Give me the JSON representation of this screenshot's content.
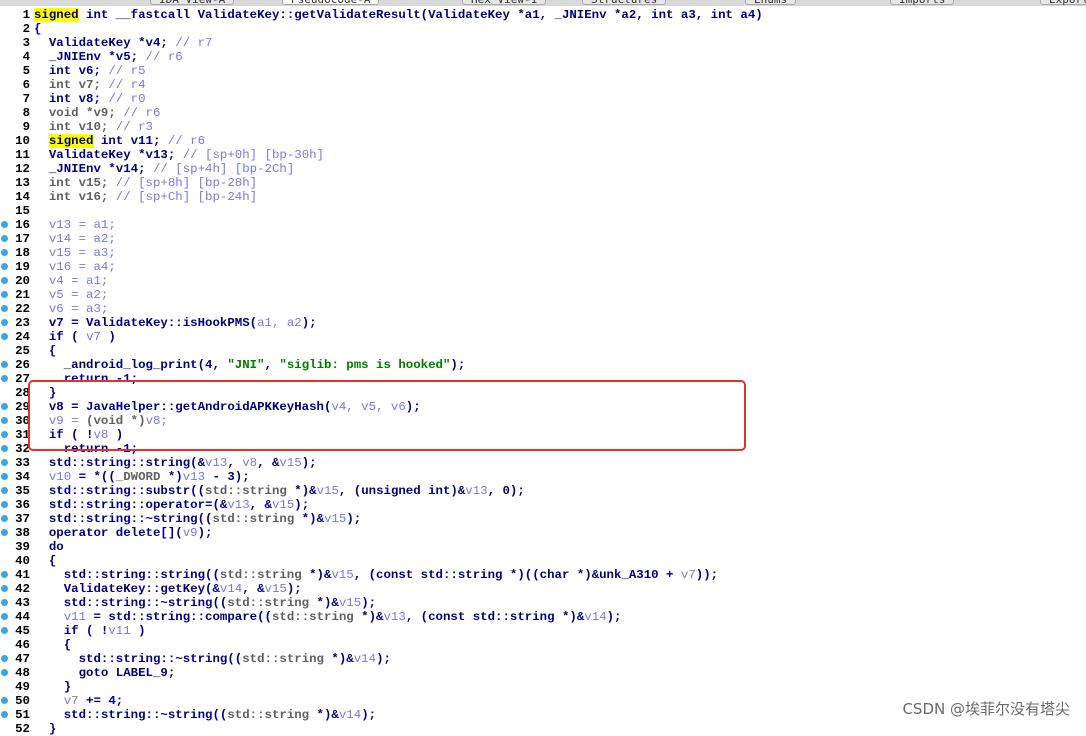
{
  "tabs": [
    {
      "label": "IDA View-A"
    },
    {
      "label": "Pseudocode-A"
    },
    {
      "label": "Hex View-1"
    },
    {
      "label": "Structures"
    },
    {
      "label": "Enums"
    },
    {
      "label": "Imports"
    },
    {
      "label": "Exports"
    }
  ],
  "colors": {
    "keyword": "#000080",
    "comment": "#7878e6",
    "string": "#007a00",
    "highlight": "#ffff00",
    "breakpoint_dot": "#39a6ea",
    "annotation_box": "#e4322b"
  },
  "lines": [
    {
      "n": "1",
      "dot": false,
      "parts": [
        [
          "signed",
          "hl"
        ],
        [
          " int __fastcall ValidateKey::getValidateResult(ValidateKey *a1, _JNIEnv *a2, int a3, int a4)",
          "p"
        ]
      ]
    },
    {
      "n": "2",
      "dot": false,
      "parts": [
        [
          "{",
          "p"
        ]
      ]
    },
    {
      "n": "3",
      "dot": false,
      "parts": [
        [
          "  ValidateKey *v4; ",
          "p"
        ],
        [
          "// r7",
          "c"
        ]
      ]
    },
    {
      "n": "4",
      "dot": false,
      "parts": [
        [
          "  _JNIEnv *v5; ",
          "p"
        ],
        [
          "// r6",
          "c"
        ]
      ]
    },
    {
      "n": "5",
      "dot": false,
      "parts": [
        [
          "  int v6; ",
          "p"
        ],
        [
          "// r5",
          "c"
        ]
      ]
    },
    {
      "n": "6",
      "dot": false,
      "parts": [
        [
          "  int v7; ",
          "g"
        ],
        [
          "// r4",
          "c"
        ]
      ]
    },
    {
      "n": "7",
      "dot": false,
      "parts": [
        [
          "  int v8; ",
          "p"
        ],
        [
          "// r0",
          "c"
        ]
      ]
    },
    {
      "n": "8",
      "dot": false,
      "parts": [
        [
          "  void *v9; ",
          "g"
        ],
        [
          "// r6",
          "c"
        ]
      ]
    },
    {
      "n": "9",
      "dot": false,
      "parts": [
        [
          "  int v10; ",
          "g"
        ],
        [
          "// r3",
          "c"
        ]
      ]
    },
    {
      "n": "10",
      "dot": false,
      "parts": [
        [
          "  ",
          "p"
        ],
        [
          "signed",
          "hl"
        ],
        [
          " int v11; ",
          "p"
        ],
        [
          "// r6",
          "c"
        ]
      ]
    },
    {
      "n": "11",
      "dot": false,
      "parts": [
        [
          "  ValidateKey *v13; ",
          "p"
        ],
        [
          "// [sp+0h] [bp-30h]",
          "c"
        ]
      ]
    },
    {
      "n": "12",
      "dot": false,
      "parts": [
        [
          "  _JNIEnv *v14; ",
          "p"
        ],
        [
          "// [sp+4h] [bp-2Ch]",
          "c"
        ]
      ]
    },
    {
      "n": "13",
      "dot": false,
      "parts": [
        [
          "  int v15; ",
          "g"
        ],
        [
          "// [sp+8h] [bp-28h]",
          "c"
        ]
      ]
    },
    {
      "n": "14",
      "dot": false,
      "parts": [
        [
          "  int v16; ",
          "g"
        ],
        [
          "// [sp+Ch] [bp-24h]",
          "c"
        ]
      ]
    },
    {
      "n": "15",
      "dot": false,
      "parts": [
        [
          "",
          "p"
        ]
      ]
    },
    {
      "n": "16",
      "dot": true,
      "parts": [
        [
          "  v13 = a1;",
          "c"
        ]
      ]
    },
    {
      "n": "17",
      "dot": true,
      "parts": [
        [
          "  v14 = a2;",
          "c"
        ]
      ]
    },
    {
      "n": "18",
      "dot": true,
      "parts": [
        [
          "  v15 = a3;",
          "c"
        ]
      ]
    },
    {
      "n": "19",
      "dot": true,
      "parts": [
        [
          "  v16 = a4;",
          "c"
        ]
      ]
    },
    {
      "n": "20",
      "dot": true,
      "parts": [
        [
          "  v4 = a1;",
          "c"
        ]
      ]
    },
    {
      "n": "21",
      "dot": true,
      "parts": [
        [
          "  v5 = a2;",
          "c"
        ]
      ]
    },
    {
      "n": "22",
      "dot": true,
      "parts": [
        [
          "  v6 = a3;",
          "c"
        ]
      ]
    },
    {
      "n": "23",
      "dot": true,
      "parts": [
        [
          "  v7 = ValidateKey::isHookPMS(",
          "p"
        ],
        [
          "a1, a2",
          "c"
        ],
        [
          ");",
          "p"
        ]
      ]
    },
    {
      "n": "24",
      "dot": true,
      "parts": [
        [
          "  if ( ",
          "p"
        ],
        [
          "v7",
          "c"
        ],
        [
          " )",
          "p"
        ]
      ]
    },
    {
      "n": "25",
      "dot": false,
      "parts": [
        [
          "  {",
          "p"
        ]
      ]
    },
    {
      "n": "26",
      "dot": true,
      "parts": [
        [
          "    _android_log_print(4, ",
          "p"
        ],
        [
          "\"JNI\"",
          "s"
        ],
        [
          ", ",
          "p"
        ],
        [
          "\"siglib: pms is hooked\"",
          "s"
        ],
        [
          ");",
          "p"
        ]
      ]
    },
    {
      "n": "27",
      "dot": true,
      "parts": [
        [
          "    return -1;",
          "p"
        ]
      ]
    },
    {
      "n": "28",
      "dot": false,
      "parts": [
        [
          "  }",
          "p"
        ]
      ]
    },
    {
      "n": "29",
      "dot": true,
      "parts": [
        [
          "  v8 = JavaHelper::getAndroidAPKKeyHash(",
          "p"
        ],
        [
          "v4, v5, v6",
          "c"
        ],
        [
          ");",
          "p"
        ]
      ]
    },
    {
      "n": "30",
      "dot": true,
      "parts": [
        [
          "  v9 = ",
          "c"
        ],
        [
          "(void *)",
          "g"
        ],
        [
          "v8;",
          "c"
        ]
      ]
    },
    {
      "n": "31",
      "dot": true,
      "parts": [
        [
          "  if ( !",
          "p"
        ],
        [
          "v8",
          "c"
        ],
        [
          " )",
          "p"
        ]
      ]
    },
    {
      "n": "32",
      "dot": true,
      "parts": [
        [
          "    return -1;",
          "p"
        ]
      ]
    },
    {
      "n": "33",
      "dot": true,
      "parts": [
        [
          "  std::string::string(&",
          "p"
        ],
        [
          "v13",
          "c"
        ],
        [
          ", ",
          "p"
        ],
        [
          "v8",
          "c"
        ],
        [
          ", &",
          "p"
        ],
        [
          "v15",
          "c"
        ],
        [
          ");",
          "p"
        ]
      ]
    },
    {
      "n": "34",
      "dot": true,
      "parts": [
        [
          "  ",
          "p"
        ],
        [
          "v10",
          "c"
        ],
        [
          " = *((",
          "p"
        ],
        [
          "_DWORD",
          "g"
        ],
        [
          " *)",
          "p"
        ],
        [
          "v13",
          "c"
        ],
        [
          " - 3);",
          "p"
        ]
      ]
    },
    {
      "n": "35",
      "dot": true,
      "parts": [
        [
          "  std::string::substr((",
          "p"
        ],
        [
          "std::string",
          "g"
        ],
        [
          " *)&",
          "p"
        ],
        [
          "v15",
          "c"
        ],
        [
          ", (unsigned int)&",
          "p"
        ],
        [
          "v13",
          "c"
        ],
        [
          ", 0);",
          "p"
        ]
      ]
    },
    {
      "n": "36",
      "dot": true,
      "parts": [
        [
          "  std::string::operator=(&",
          "p"
        ],
        [
          "v13",
          "c"
        ],
        [
          ", &",
          "p"
        ],
        [
          "v15",
          "c"
        ],
        [
          ");",
          "p"
        ]
      ]
    },
    {
      "n": "37",
      "dot": true,
      "parts": [
        [
          "  std::string::~string((",
          "p"
        ],
        [
          "std::string",
          "g"
        ],
        [
          " *)&",
          "p"
        ],
        [
          "v15",
          "c"
        ],
        [
          ");",
          "p"
        ]
      ]
    },
    {
      "n": "38",
      "dot": true,
      "parts": [
        [
          "  operator delete[](",
          "p"
        ],
        [
          "v9",
          "c"
        ],
        [
          ");",
          "p"
        ]
      ]
    },
    {
      "n": "39",
      "dot": false,
      "parts": [
        [
          "  do",
          "p"
        ]
      ]
    },
    {
      "n": "40",
      "dot": false,
      "parts": [
        [
          "  {",
          "p"
        ]
      ]
    },
    {
      "n": "41",
      "dot": true,
      "parts": [
        [
          "    std::string::string((",
          "p"
        ],
        [
          "std::string",
          "g"
        ],
        [
          " *)&",
          "p"
        ],
        [
          "v15",
          "c"
        ],
        [
          ", (const std::string *)((char *)&unk_A310 + ",
          "p"
        ],
        [
          "v7",
          "c"
        ],
        [
          "));",
          "p"
        ]
      ]
    },
    {
      "n": "42",
      "dot": true,
      "parts": [
        [
          "    ValidateKey::getKey(&",
          "p"
        ],
        [
          "v14",
          "c"
        ],
        [
          ", &",
          "p"
        ],
        [
          "v15",
          "c"
        ],
        [
          ");",
          "p"
        ]
      ]
    },
    {
      "n": "43",
      "dot": true,
      "parts": [
        [
          "    std::string::~string((",
          "p"
        ],
        [
          "std::string",
          "g"
        ],
        [
          " *)&",
          "p"
        ],
        [
          "v15",
          "c"
        ],
        [
          ");",
          "p"
        ]
      ]
    },
    {
      "n": "44",
      "dot": true,
      "parts": [
        [
          "    ",
          "p"
        ],
        [
          "v11",
          "c"
        ],
        [
          " = std::string::compare((",
          "p"
        ],
        [
          "std::string",
          "g"
        ],
        [
          " *)&",
          "p"
        ],
        [
          "v13",
          "c"
        ],
        [
          ", (const std::string *)&",
          "p"
        ],
        [
          "v14",
          "c"
        ],
        [
          ");",
          "p"
        ]
      ]
    },
    {
      "n": "45",
      "dot": true,
      "parts": [
        [
          "    if ( !",
          "p"
        ],
        [
          "v11",
          "c"
        ],
        [
          " )",
          "p"
        ]
      ]
    },
    {
      "n": "46",
      "dot": false,
      "parts": [
        [
          "    {",
          "p"
        ]
      ]
    },
    {
      "n": "47",
      "dot": true,
      "parts": [
        [
          "      std::string::~string((",
          "p"
        ],
        [
          "std::string",
          "g"
        ],
        [
          " *)&",
          "p"
        ],
        [
          "v14",
          "c"
        ],
        [
          ");",
          "p"
        ]
      ]
    },
    {
      "n": "48",
      "dot": true,
      "parts": [
        [
          "      goto LABEL_9;",
          "p"
        ]
      ]
    },
    {
      "n": "49",
      "dot": false,
      "parts": [
        [
          "    }",
          "p"
        ]
      ]
    },
    {
      "n": "50",
      "dot": true,
      "parts": [
        [
          "    ",
          "p"
        ],
        [
          "v7",
          "c"
        ],
        [
          " += 4;",
          "p"
        ]
      ]
    },
    {
      "n": "51",
      "dot": true,
      "parts": [
        [
          "    std::string::~string((",
          "p"
        ],
        [
          "std::string",
          "g"
        ],
        [
          " *)&",
          "p"
        ],
        [
          "v14",
          "c"
        ],
        [
          ");",
          "p"
        ]
      ]
    },
    {
      "n": "52",
      "dot": false,
      "parts": [
        [
          "  }",
          "p"
        ]
      ]
    }
  ],
  "watermark": "CSDN @埃菲尔没有塔尖"
}
